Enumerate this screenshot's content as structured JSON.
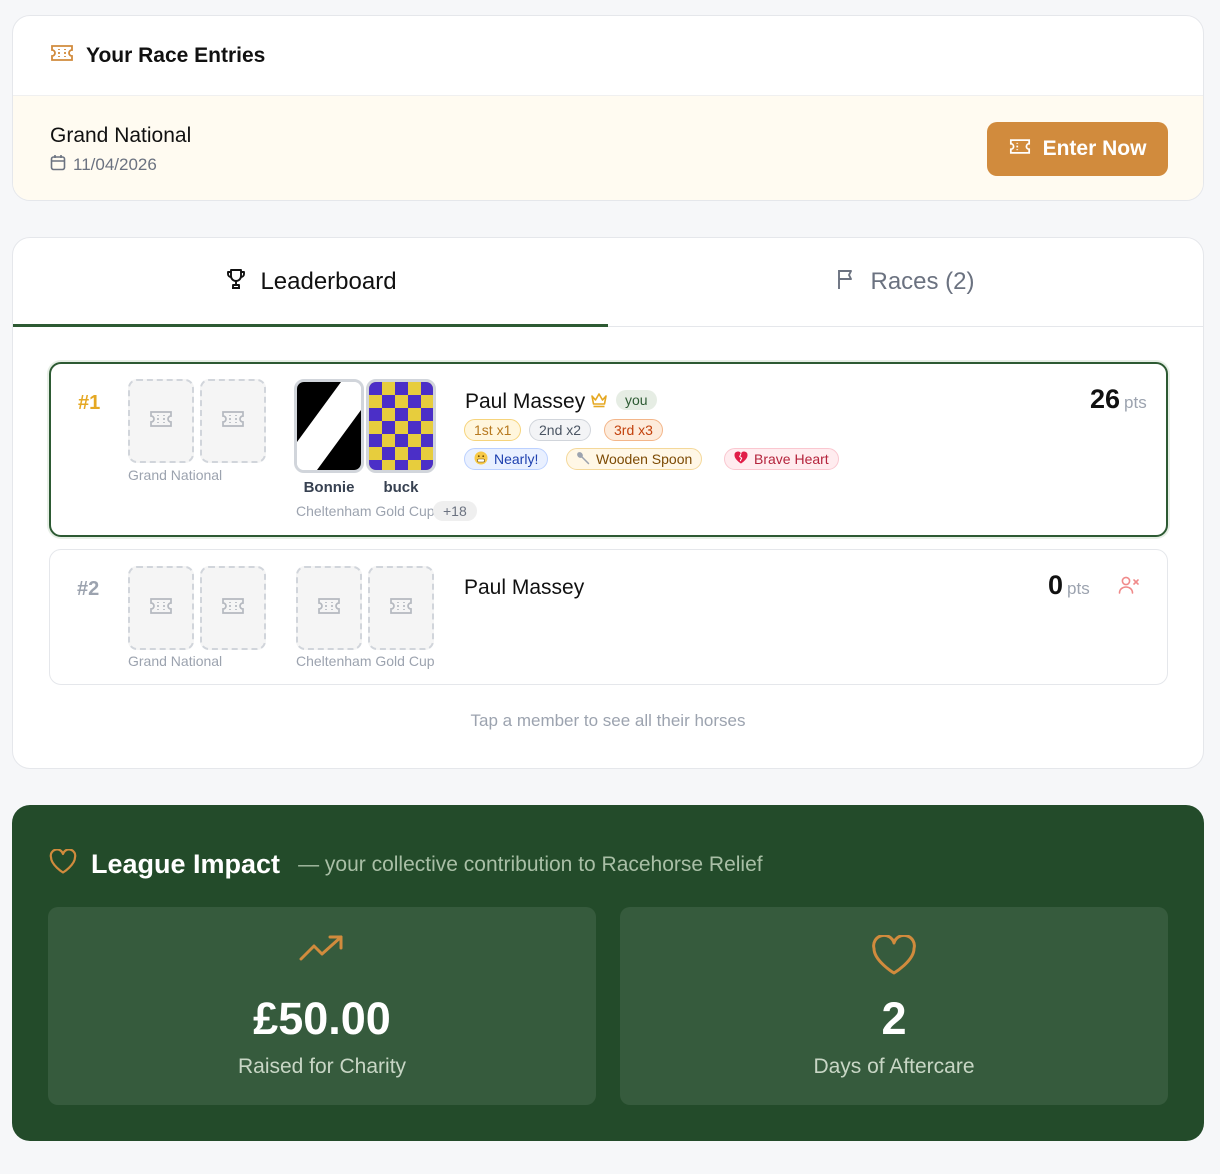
{
  "colors": {
    "accent": "#d18b3d",
    "brand_green": "#2d5a33",
    "impact_bg": "#234b2a",
    "gold": "#e5a823"
  },
  "entries": {
    "title": "Your Race Entries",
    "icon": "ticket-icon",
    "race_name": "Grand National",
    "race_date": "11/04/2026",
    "enter_label": "Enter Now"
  },
  "tabs": [
    {
      "label": "Leaderboard",
      "icon": "trophy-icon",
      "active": true
    },
    {
      "label": "Races (2)",
      "icon": "flag-icon",
      "active": false
    }
  ],
  "members": [
    {
      "rank": "#1",
      "name": "Paul Massey",
      "you_badge": "you",
      "points": "26",
      "points_unit": "pts",
      "race1_label": "Grand National",
      "race2_label": "Cheltenham Gold Cup",
      "horses": [
        "Bonnie",
        "buck"
      ],
      "more": "+18",
      "placings": [
        "1st x1",
        "2nd x2",
        "3rd x3"
      ],
      "awards": [
        "Nearly!",
        "Wooden Spoon",
        "Brave Heart"
      ]
    },
    {
      "rank": "#2",
      "name": "Paul Massey",
      "points": "0",
      "points_unit": "pts",
      "race1_label": "Grand National",
      "race2_label": "Cheltenham Gold Cup"
    }
  ],
  "hint": "Tap a member to see all their horses",
  "impact": {
    "title": "League Impact",
    "subtitle": "— your collective contribution to Racehorse Relief",
    "stats": [
      {
        "value": "£50.00",
        "label": "Raised for Charity",
        "icon": "trending-up-icon"
      },
      {
        "value": "2",
        "label": "Days of Aftercare",
        "icon": "heart-icon"
      }
    ]
  }
}
